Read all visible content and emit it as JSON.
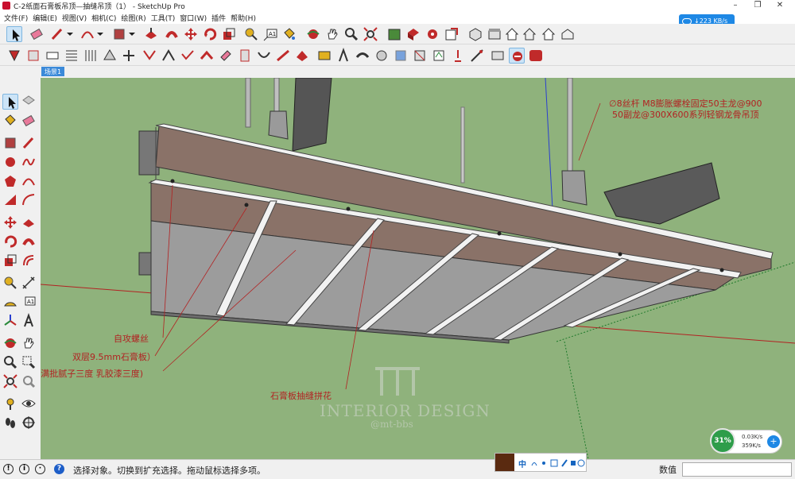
{
  "window": {
    "title": "C-2纸面石膏板吊顶—抽缝吊顶（1） - SketchUp Pro",
    "minimize": "–",
    "maximize": "❐",
    "close": "✕"
  },
  "menu": [
    "文件(F)",
    "编辑(E)",
    "视图(V)",
    "相机(C)",
    "绘图(R)",
    "工具(T)",
    "窗口(W)",
    "插件",
    "帮助(H)"
  ],
  "network": {
    "speed": "↓223 KB/s"
  },
  "scene": {
    "tab": "场景1"
  },
  "annotations": {
    "rod_line1": "∅8丝杆 M8膨胀螺栓固定50主龙@900",
    "rod_line2": "50副龙@300X600系列轻钢龙骨吊顶",
    "screw": "自攻螺丝",
    "board": "双层9.5mm石膏板）",
    "paint": "(满批腻子三度 乳胶漆三度)",
    "seam": "石膏板抽缝拼花"
  },
  "watermark": {
    "title": "INTERIOR DESIGN",
    "sub": "@mt-bbs"
  },
  "status": {
    "message": "选择对象。切换到扩充选择。拖动鼠标选择多项。",
    "measurements_label": "数值",
    "measurements_value": ""
  },
  "ime": {
    "mode": "中"
  },
  "perf": {
    "cpu": "31%",
    "up": "0.03K/s",
    "down": "359K/s",
    "plus": "+"
  },
  "colors": {
    "viewport_bg": "#8fb27c",
    "board_top": "#8a7268",
    "board_face": "#9a9a9a",
    "seam_white": "#f2f2f2",
    "annotation": "#b22222",
    "axis_red": "#b22222",
    "axis_blue": "#2a3fd0",
    "axis_green": "#1e7a2a"
  }
}
